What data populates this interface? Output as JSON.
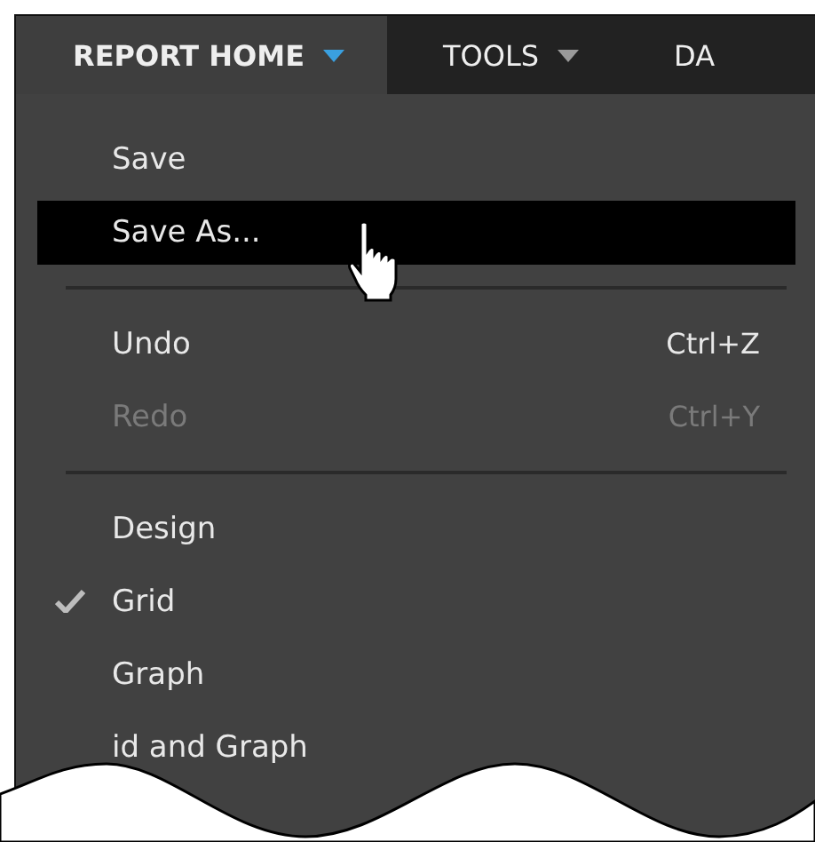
{
  "menu_bar": {
    "tabs": [
      {
        "label": "REPORT HOME",
        "selected": true
      },
      {
        "label": "TOOLS",
        "selected": false
      },
      {
        "label": "DA",
        "selected": false
      }
    ]
  },
  "menu": {
    "items": [
      {
        "kind": "item",
        "label": "Save",
        "checked": false,
        "disabled": false,
        "selected": false
      },
      {
        "kind": "item",
        "label": "Save As...",
        "checked": false,
        "disabled": false,
        "selected": true
      },
      {
        "kind": "separator"
      },
      {
        "kind": "item",
        "label": "Undo",
        "shortcut": "Ctrl+Z",
        "checked": false,
        "disabled": false,
        "selected": false
      },
      {
        "kind": "item",
        "label": "Redo",
        "shortcut": "Ctrl+Y",
        "checked": false,
        "disabled": true,
        "selected": false
      },
      {
        "kind": "separator"
      },
      {
        "kind": "item",
        "label": "Design",
        "checked": false,
        "disabled": false,
        "selected": false
      },
      {
        "kind": "item",
        "label": "Grid",
        "checked": true,
        "disabled": false,
        "selected": false
      },
      {
        "kind": "item",
        "label": "Graph",
        "checked": false,
        "disabled": false,
        "selected": false
      },
      {
        "kind": "item",
        "label": "id and Graph",
        "checked": false,
        "disabled": false,
        "selected": false
      }
    ]
  }
}
